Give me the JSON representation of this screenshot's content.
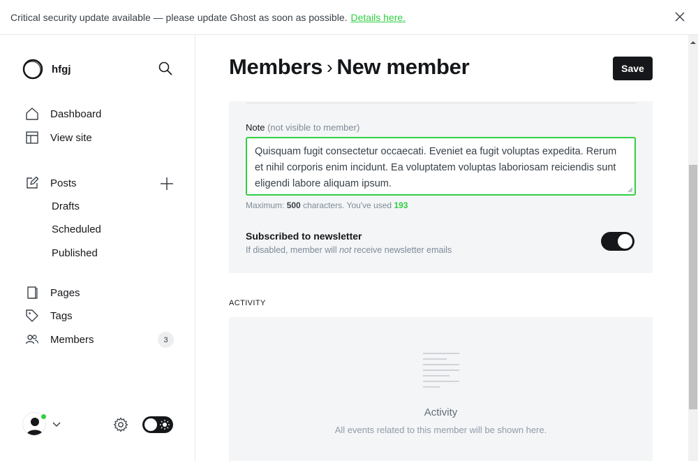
{
  "banner": {
    "message": "Critical security update available — please update Ghost as soon as possible.",
    "link": "Details here."
  },
  "sidebar": {
    "site_name": "hfgj",
    "nav": [
      {
        "label": "Dashboard",
        "icon": "home-icon"
      },
      {
        "label": "View site",
        "icon": "layout-icon"
      },
      {
        "label": "Posts",
        "icon": "edit-icon"
      },
      {
        "label": "Pages",
        "icon": "page-icon"
      },
      {
        "label": "Tags",
        "icon": "tag-icon"
      },
      {
        "label": "Members",
        "icon": "members-icon"
      }
    ],
    "posts_sub": [
      "Drafts",
      "Scheduled",
      "Published"
    ],
    "members_count": "3"
  },
  "header": {
    "breadcrumb_parent": "Members",
    "breadcrumb_sep": "›",
    "title": "New member",
    "save_label": "Save"
  },
  "note": {
    "label": "Note",
    "hint": "(not visible to member)",
    "value": "Quisquam fugit consectetur occaecati. Eveniet ea fugit voluptas expedita. Rerum et nihil corporis enim incidunt. Ea voluptatem voluptas laboriosam reiciendis sunt eligendi labore aliquam ipsum.",
    "counter_prefix": "Maximum:",
    "max": "500",
    "counter_mid": "characters. You've used",
    "used": "193"
  },
  "newsletter": {
    "title": "Subscribed to newsletter",
    "desc_before": "If disabled, member will",
    "desc_em": "not",
    "desc_after": "receive newsletter emails",
    "enabled": true
  },
  "activity": {
    "heading": "ACTIVITY",
    "title": "Activity",
    "desc": "All events related to this member will be shown here."
  },
  "colors": {
    "accent": "#30cf43",
    "dark": "#15171a",
    "panel": "#f4f5f6"
  }
}
